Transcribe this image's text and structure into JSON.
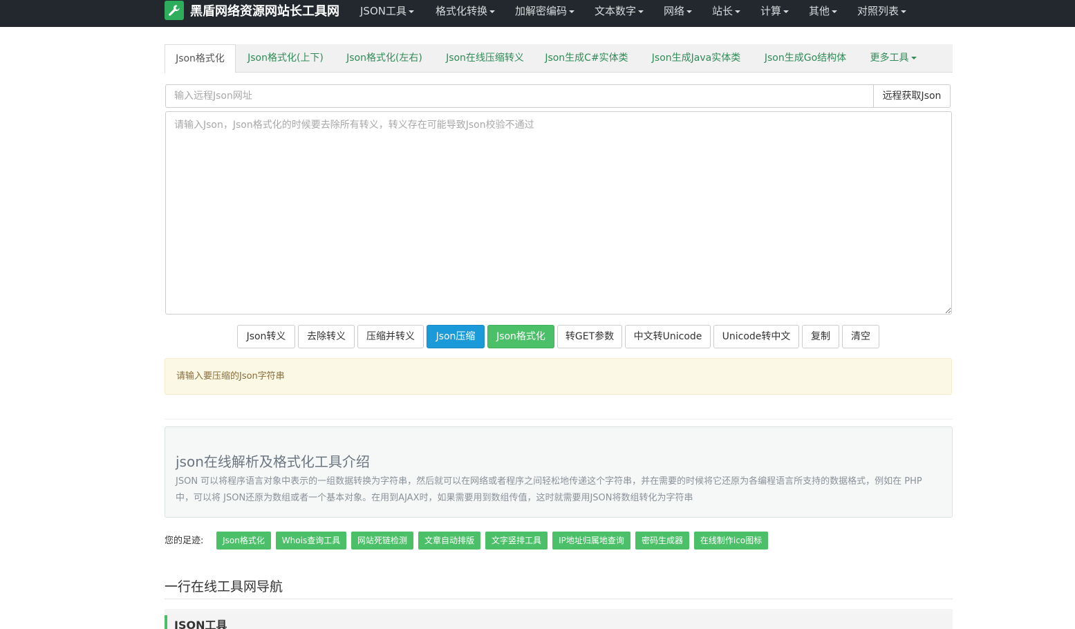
{
  "navbar": {
    "brand": "黑盾网络资源网站长工具网",
    "items": [
      "JSON工具",
      "格式化转换",
      "加解密编码",
      "文本数字",
      "网络",
      "站长",
      "计算",
      "其他",
      "对照列表"
    ]
  },
  "tabs": [
    "Json格式化",
    "Json格式化(上下)",
    "Json格式化(左右)",
    "Json在线压缩转义",
    "Json生成C#实体类",
    "Json生成Java实体类",
    "Json生成Go结构体",
    "更多工具"
  ],
  "url_input": {
    "placeholder": "输入远程Json网址",
    "button": "远程获取Json"
  },
  "json_input": {
    "placeholder": "请输入Json，Json格式化的时候要去除所有转义，转义存在可能导致Json校验不通过"
  },
  "buttons": [
    "Json转义",
    "去除转义",
    "压缩并转义",
    "Json压缩",
    "Json格式化",
    "转GET参数",
    "中文转Unicode",
    "Unicode转中文",
    "复制",
    "清空"
  ],
  "alert": "请输入要压缩的Json字符串",
  "intro": {
    "title": "json在线解析及格式化工具介绍",
    "text": "JSON 可以将程序语言对象中表示的一组数据转换为字符串，然后就可以在网络或者程序之间轻松地传递这个字符串，并在需要的时候将它还原为各编程语言所支持的数据格式，例如在 PHP 中，可以将 JSON还原为数组或者一个基本对象。在用到AJAX时，如果需要用到数组传值，这时就需要用JSON将数组转化为字符串"
  },
  "footprint": {
    "label": "您的足迹:",
    "tags": [
      "Json格式化",
      "Whois查询工具",
      "网站死链检测",
      "文章自动排版",
      "文字竖排工具",
      "IP地址归属地查询",
      "密码生成器",
      "在线制作ico图标"
    ]
  },
  "nav_section": {
    "title": "一行在线工具网导航",
    "category": "JSON工具"
  },
  "colors": {
    "navbar": "#22282e",
    "accent_green": "#4cc068",
    "info_blue": "#1a9ad8",
    "tab_link": "#2e8b57"
  },
  "icons": {
    "brand": "wrench-icon",
    "dropdown": "caret-down-icon"
  }
}
